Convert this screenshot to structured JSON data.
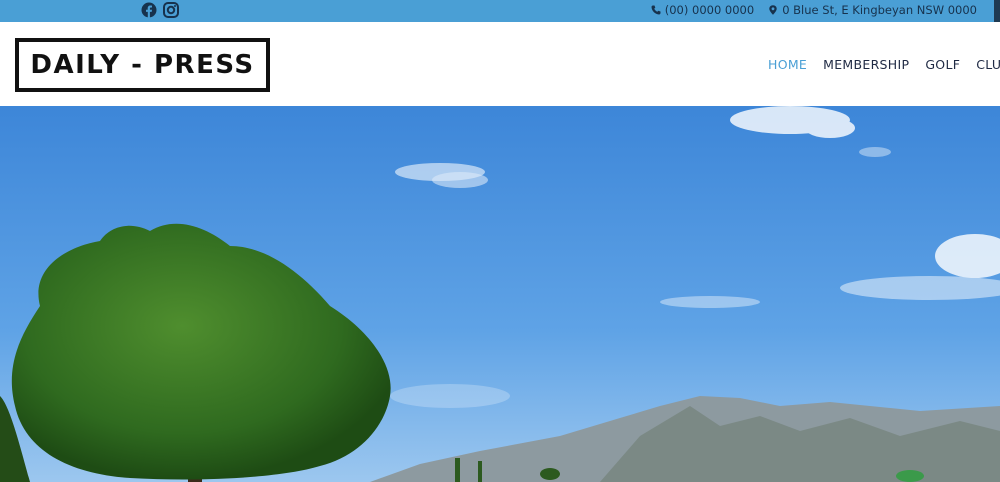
{
  "topbar": {
    "social": [
      {
        "icon": "facebook-icon"
      },
      {
        "icon": "instagram-icon"
      }
    ],
    "phone": "(00) 0000 0000",
    "address": "0 Blue St, E Kingbeyan NSW 0000",
    "colors": {
      "bar": "#4a9fd5",
      "text": "#17324d"
    }
  },
  "header": {
    "logo": "DAILY - PRESS",
    "nav": [
      {
        "label": "HOME",
        "active": true
      },
      {
        "label": "MEMBERSHIP",
        "active": false
      },
      {
        "label": "GOLF",
        "active": false
      },
      {
        "label": "CLUB",
        "active": false
      }
    ],
    "colors": {
      "active": "#4a9fd5",
      "text": "#1f2a44"
    }
  },
  "hero": {
    "image": "sky-tree-mountain-photo"
  }
}
